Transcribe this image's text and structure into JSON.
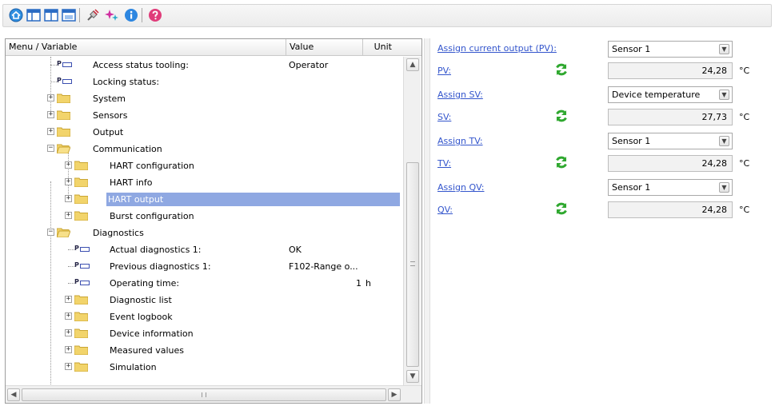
{
  "toolbar": {
    "buttons": [
      "home-icon",
      "layout-tree-icon",
      "layout-split-icon",
      "layout-window-icon",
      "connect-plug-icon",
      "sparkle-wizard-icon",
      "info-icon",
      "help-icon"
    ]
  },
  "tree": {
    "col_menu": "Menu / Variable",
    "col_value": "Value",
    "col_unit": "Unit",
    "rows": [
      {
        "label": "Access status tooling:",
        "value": "Operator"
      },
      {
        "label": "Locking status:",
        "value": ""
      },
      {
        "label": "System"
      },
      {
        "label": "Sensors"
      },
      {
        "label": "Output"
      },
      {
        "label": "Communication"
      },
      {
        "label": "HART configuration"
      },
      {
        "label": "HART info"
      },
      {
        "label": "HART output"
      },
      {
        "label": "Burst configuration"
      },
      {
        "label": "Diagnostics"
      },
      {
        "label": "Actual diagnostics 1:",
        "value": "OK"
      },
      {
        "label": "Previous diagnostics 1:",
        "value": "F102-Range o..."
      },
      {
        "label": "Operating time:",
        "value": "1",
        "unit": "h"
      },
      {
        "label": "Diagnostic list"
      },
      {
        "label": "Event logbook"
      },
      {
        "label": "Device information"
      },
      {
        "label": "Measured values"
      },
      {
        "label": "Simulation"
      }
    ]
  },
  "panel": {
    "assign_pv_label": "Assign current output (PV):",
    "assign_pv_value": "Sensor 1",
    "pv_label": "PV:",
    "pv_value": "24,28",
    "pv_unit": "°C",
    "assign_sv_label": "Assign SV:",
    "assign_sv_value": "Device temperature",
    "sv_label": "SV:",
    "sv_value": "27,73",
    "sv_unit": "°C",
    "assign_tv_label": "Assign TV:",
    "assign_tv_value": "Sensor 1",
    "tv_label": "TV:",
    "tv_value": "24,28",
    "tv_unit": "°C",
    "assign_qv_label": "Assign QV:",
    "assign_qv_value": "Sensor 1",
    "qv_label": "QV:",
    "qv_value": "24,28",
    "qv_unit": "°C"
  },
  "colors": {
    "selection": "#8fa8e2",
    "link": "#3355cc",
    "refresh_green": "#2fa82f"
  }
}
